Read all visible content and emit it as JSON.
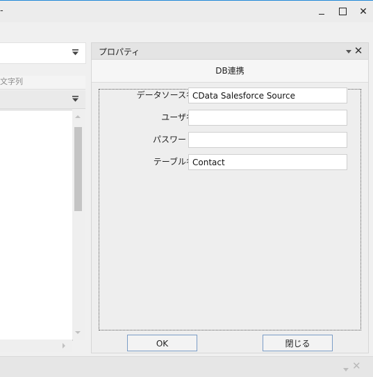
{
  "window": {
    "title_fragment": "-",
    "minimize_glyph": "_",
    "maximize_glyph": "□",
    "close_glyph": "✕"
  },
  "left_panel": {
    "search_placeholder": "文字列"
  },
  "properties": {
    "panel_title": "プロパティ",
    "close_glyph": "✕",
    "header": "DB連携",
    "fields": [
      {
        "label": "データソース名",
        "value": "CData Salesforce Source"
      },
      {
        "label": "ユーザ名",
        "value": ""
      },
      {
        "label": "パスワード",
        "value": ""
      },
      {
        "label": "テーブル名",
        "value": "Contact"
      }
    ],
    "ok_label": "OK",
    "close_label": "閉じる"
  },
  "bottom_panel": {
    "close_glyph": "✕"
  },
  "colors": {
    "accent": "#1e88d8",
    "button_border": "#7a9cc6"
  }
}
